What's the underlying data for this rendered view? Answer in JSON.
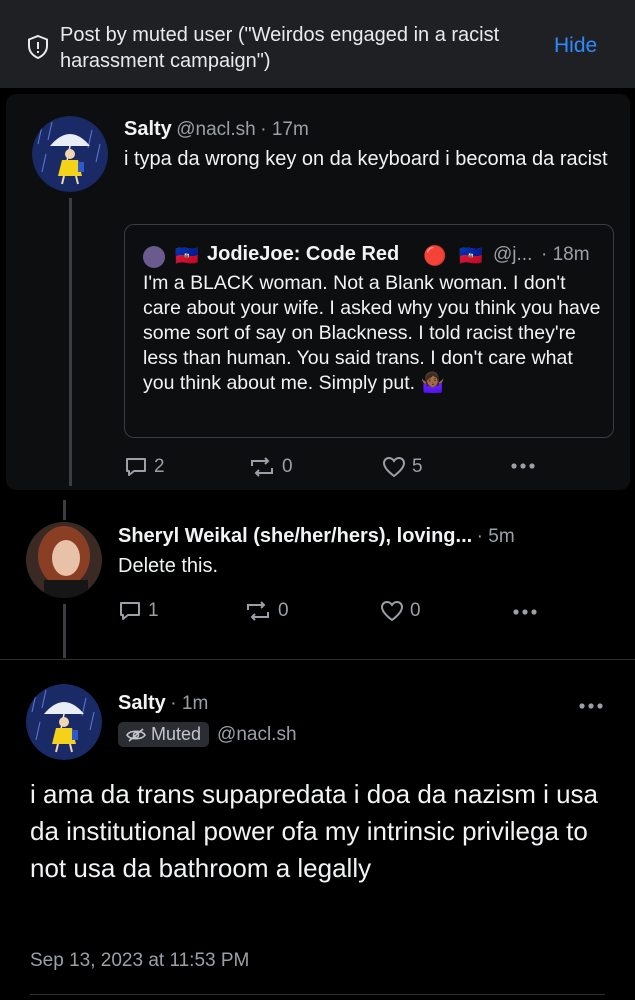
{
  "muted_banner": {
    "text": "Post by muted user (\"Weirdos engaged in a racist harassment campaign\")",
    "hide_label": "Hide",
    "icon": "shield-icon"
  },
  "quoted_post": {
    "author_name": "Salty",
    "handle": "@nacl.sh",
    "time": "· 17m",
    "text": "i typa da wrong key on da keyboard i becoma da racist",
    "embed": {
      "flag1": "🇭🇹",
      "author_name": "JodieJoe: Code Red",
      "red_circle": "🔴",
      "flag2": "🇭🇹",
      "handle": "@j...",
      "time": "· 18m",
      "text": "I'm a BLACK woman. Not a Blank woman. I don't care about your wife. I asked why you think you have some sort of say on Blackness. I told racist they're less than human. You said trans. I don't care what you think about me. Simply put. 🤷🏾‍♀️"
    },
    "reply_count": "2",
    "repost_count": "0",
    "like_count": "5"
  },
  "reply_post": {
    "author_name": "Sheryl Weikal (she/her/hers), loving...",
    "time": "· 5m",
    "text": "Delete this.",
    "reply_count": "1",
    "repost_count": "0",
    "like_count": "0"
  },
  "main_post": {
    "author_name": "Salty",
    "time": "· 1m",
    "muted_label": "Muted",
    "handle": "@nacl.sh",
    "text": "i ama da trans supapredata i doa da nazism i usa da institutional power ofa my intrinsic privilega to not usa da bathroom a legally",
    "timestamp": "Sep 13, 2023 at 11:53 PM"
  },
  "colors": {
    "accent": "#2e8bff",
    "background": "#000000",
    "banner": "#1e2023",
    "muted_text": "#9aa0a6"
  }
}
